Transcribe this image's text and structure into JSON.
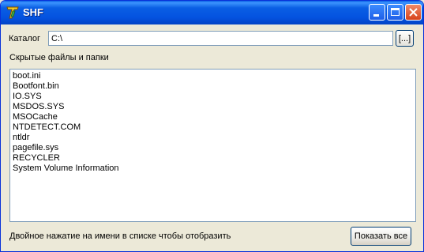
{
  "window": {
    "title": "SHF"
  },
  "catalog": {
    "label": "Каталог",
    "value": "C:\\",
    "browse_label": "[...]"
  },
  "section": {
    "label": "Скрытые файлы и папки"
  },
  "files": [
    "boot.ini",
    "Bootfont.bin",
    "IO.SYS",
    "MSDOS.SYS",
    "MSOCache",
    "NTDETECT.COM",
    "ntldr",
    "pagefile.sys",
    "RECYCLER",
    "System Volume Information"
  ],
  "footer": {
    "hint": "Двойное нажатие на имени в списке чтобы отобразить",
    "show_all_label": "Показать все"
  }
}
